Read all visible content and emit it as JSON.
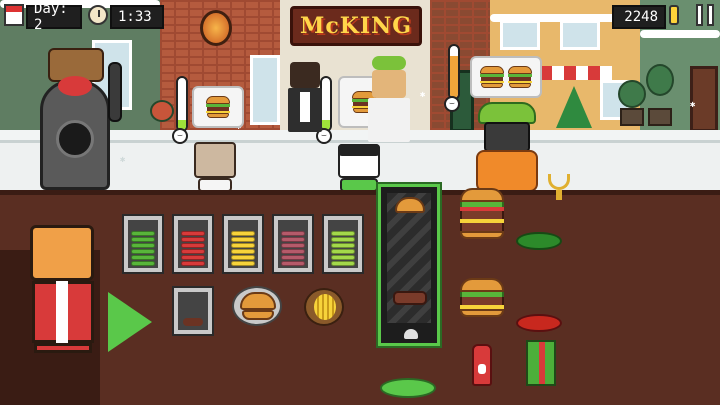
{
  "hud": {
    "day_label": "Day: 2",
    "time": "1:33",
    "coins": "2248"
  },
  "restaurant": {
    "sign": "McKING"
  },
  "icons": {
    "calendar": "calendar-icon",
    "clock": "clock-icon",
    "coin": "coin-icon",
    "pause": "pause-icon"
  },
  "customers": [
    {
      "name": "cat-customer-left",
      "patience": 0.2,
      "patience_color": "#9ee23a",
      "order_count": 1
    },
    {
      "name": "dog-customer-center",
      "patience": 0.2,
      "patience_color": "#9ee23a",
      "order_count": 1
    },
    {
      "name": "frog-hat-customer-right",
      "patience": 0.8,
      "patience_color": "#f0a53a",
      "order_count": 2
    }
  ],
  "ingredients": [
    {
      "name": "lettuce-bin",
      "color": "#58b53a"
    },
    {
      "name": "tomato-bin",
      "color": "#d83a3a"
    },
    {
      "name": "cheese-bin",
      "color": "#f7d33a"
    },
    {
      "name": "onion-bin",
      "color": "#b55a6a"
    },
    {
      "name": "pickle-bin",
      "color": "#a3d84a"
    }
  ],
  "colors": {
    "grill_border": "#5ac84a",
    "bun": "#e39a3b",
    "patty": "#7a3b2a",
    "counter": "#5a2e22"
  }
}
